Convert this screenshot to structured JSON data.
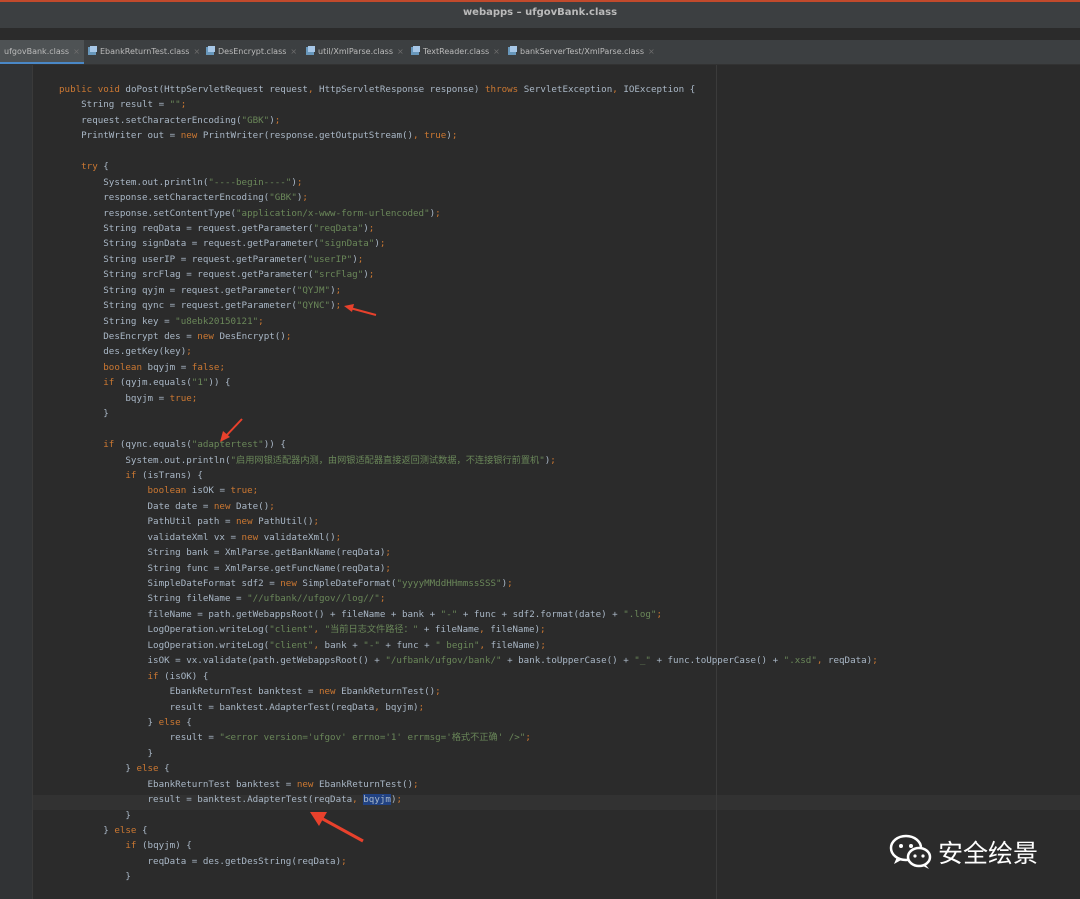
{
  "window": {
    "title": "webapps – ufgovBank.class"
  },
  "tabs": [
    {
      "label": "ufgovBank.class",
      "active": true
    },
    {
      "label": "EbankReturnTest.class",
      "active": false
    },
    {
      "label": "DesEncrypt.class",
      "active": false
    },
    {
      "label": "util/XmlParse.class",
      "active": false
    },
    {
      "label": "TextReader.class",
      "active": false
    },
    {
      "label": "bankServerTest/XmlParse.class",
      "active": false
    }
  ],
  "tab_close_glyph": "×",
  "code": {
    "lines": [
      "public void doPost(HttpServletRequest request, HttpServletResponse response) throws ServletException, IOException {",
      "    String result = \"\";",
      "    request.setCharacterEncoding(\"GBK\");",
      "    PrintWriter out = new PrintWriter(response.getOutputStream(), true);",
      "",
      "    try {",
      "        System.out.println(\"----begin----\");",
      "        response.setCharacterEncoding(\"GBK\");",
      "        response.setContentType(\"application/x-www-form-urlencoded\");",
      "        String reqData = request.getParameter(\"reqData\");",
      "        String signData = request.getParameter(\"signData\");",
      "        String userIP = request.getParameter(\"userIP\");",
      "        String srcFlag = request.getParameter(\"srcFlag\");",
      "        String qyjm = request.getParameter(\"QYJM\");",
      "        String qync = request.getParameter(\"QYNC\");",
      "        String key = \"u8ebk20150121\";",
      "        DesEncrypt des = new DesEncrypt();",
      "        des.getKey(key);",
      "        boolean bqyjm = false;",
      "        if (qyjm.equals(\"1\")) {",
      "            bqyjm = true;",
      "        }",
      "",
      "        if (qync.equals(\"adaptertest\")) {",
      "            System.out.println(\"启用网银适配器内测，由网银适配器直接返回测试数据，不连接银行前置机\");",
      "            if (isTrans) {",
      "                boolean isOK = true;",
      "                Date date = new Date();",
      "                PathUtil path = new PathUtil();",
      "                validateXml vx = new validateXml();",
      "                String bank = XmlParse.getBankName(reqData);",
      "                String func = XmlParse.getFuncName(reqData);",
      "                SimpleDateFormat sdf2 = new SimpleDateFormat(\"yyyyMMddHHmmssSSS\");",
      "                String fileName = \"//ufbank//ufgov//log//\";",
      "                fileName = path.getWebappsRoot() + fileName + bank + \"-\" + func + sdf2.format(date) + \".log\";",
      "                LogOperation.writeLog(\"client\", \"当前日志文件路径：\" + fileName, fileName);",
      "                LogOperation.writeLog(\"client\", bank + \"-\" + func + \" begin\", fileName);",
      "                isOK = vx.validate(path.getWebappsRoot() + \"/ufbank/ufgov/bank/\" + bank.toUpperCase() + \"_\" + func.toUpperCase() + \".xsd\", reqData);",
      "                if (isOK) {",
      "                    EbankReturnTest banktest = new EbankReturnTest();",
      "                    result = banktest.AdapterTest(reqData, bqyjm);",
      "                } else {",
      "                    result = \"<error version='ufgov' errno='1' errmsg='格式不正确' />\";",
      "                }",
      "            } else {",
      "                EbankReturnTest banktest = new EbankReturnTest();",
      "                result = banktest.AdapterTest(reqData, bqyjm);",
      "            }",
      "        } else {",
      "            if (bqyjm) {",
      "                reqData = des.getDesString(reqData);",
      "            }"
    ],
    "selected_token": "bqyjm",
    "selected_line": 46
  },
  "watermark": {
    "text": "安全绘景"
  },
  "colors": {
    "keyword": "#cc7832",
    "string": "#6a8759",
    "plain": "#a9b7c6",
    "method": "#ffc66d",
    "selection": "#214283",
    "arrow": "#e8412c"
  }
}
